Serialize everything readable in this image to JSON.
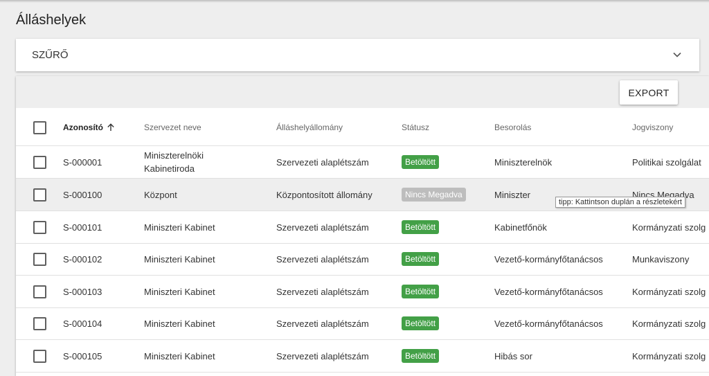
{
  "page": {
    "title": "Álláshelyek"
  },
  "filter": {
    "label": "SZŰRŐ",
    "icon": "chevron-down-icon"
  },
  "toolbar": {
    "export_label": "EXPORT"
  },
  "table": {
    "columns": [
      "Azonosító",
      "Szervezet neve",
      "Álláshelyállomány",
      "Státusz",
      "Besorolás",
      "Jogviszony"
    ],
    "sort": {
      "column": "Azonosító",
      "direction": "ascending",
      "icon": "arrow-up-icon"
    },
    "rows": [
      {
        "id": "S-000001",
        "org": "Miniszterelnöki Kabinetiroda",
        "stock": "Szervezeti alaplétszám",
        "status": "Betöltött",
        "rank": "Miniszterelnök",
        "legal": "Politikai szolgálat"
      },
      {
        "id": "S-000100",
        "org": "Központ",
        "stock": "Központosított állomány",
        "status": "Nincs Megadva",
        "rank": "Miniszter",
        "legal": "Nincs Megadva"
      },
      {
        "id": "S-000101",
        "org": "Miniszteri Kabinet",
        "stock": "Szervezeti alaplétszám",
        "status": "Betöltött",
        "rank": "Kabinetfőnök",
        "legal": "Kormányzati szolg"
      },
      {
        "id": "S-000102",
        "org": "Miniszteri Kabinet",
        "stock": "Szervezeti alaplétszám",
        "status": "Betöltött",
        "rank": "Vezető-kormányfőtanácsos",
        "legal": "Munkaviszony"
      },
      {
        "id": "S-000103",
        "org": "Miniszteri Kabinet",
        "stock": "Szervezeti alaplétszám",
        "status": "Betöltött",
        "rank": "Vezető-kormányfőtanácsos",
        "legal": "Kormányzati szolg"
      },
      {
        "id": "S-000104",
        "org": "Miniszteri Kabinet",
        "stock": "Szervezeti alaplétszám",
        "status": "Betöltött",
        "rank": "Vezető-kormányfőtanácsos",
        "legal": "Kormányzati szolg"
      },
      {
        "id": "S-000105",
        "org": "Miniszteri Kabinet",
        "stock": "Szervezeti alaplétszám",
        "status": "Betöltött",
        "rank": "Hibás sor",
        "legal": "Kormányzati szolg"
      }
    ]
  },
  "tooltip": {
    "text": "tipp: Kattintson duplán a részletekért"
  },
  "colors": {
    "status_filled": "#43a047",
    "status_unset": "#bdbdbd",
    "highlight_row": "#eeeeee"
  }
}
